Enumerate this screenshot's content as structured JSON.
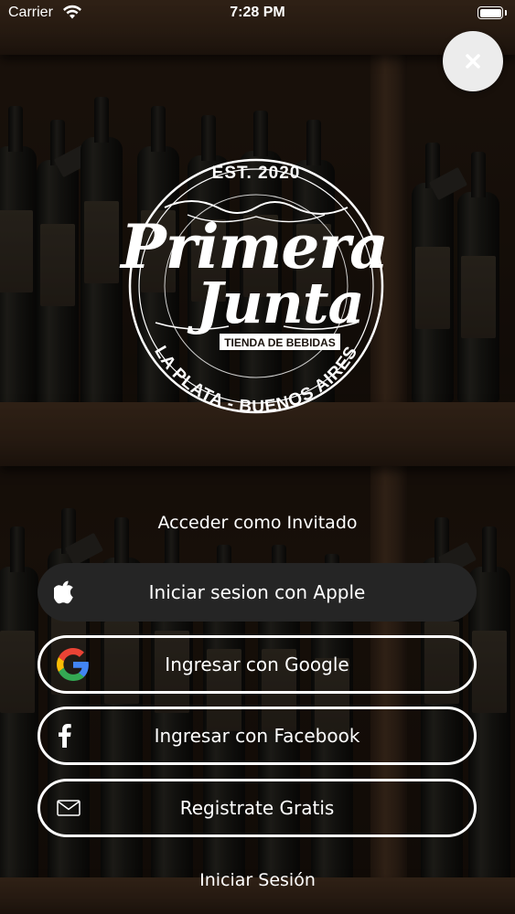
{
  "status_bar": {
    "carrier": "Carrier",
    "time": "7:28 PM"
  },
  "logo": {
    "est": "EST. 2020",
    "name_line1": "Primera",
    "name_line2": "Junta",
    "subtitle": "TIENDA DE BEBIDAS",
    "location": "LA PLATA - BUENOS AIRES"
  },
  "actions": {
    "guest_label": "Acceder como Invitado",
    "apple_label": "Iniciar sesion con Apple",
    "google_label": "Ingresar con Google",
    "facebook_label": "Ingresar con Facebook",
    "register_label": "Registrate Gratis",
    "login_label": "Iniciar Sesión"
  },
  "colors": {
    "apple_button_bg": "#252525",
    "close_button_bg": "#ececec",
    "text": "#ffffff"
  },
  "icons": [
    "close-icon",
    "apple-icon",
    "google-icon",
    "facebook-icon",
    "mail-icon",
    "wifi-icon",
    "battery-icon"
  ]
}
